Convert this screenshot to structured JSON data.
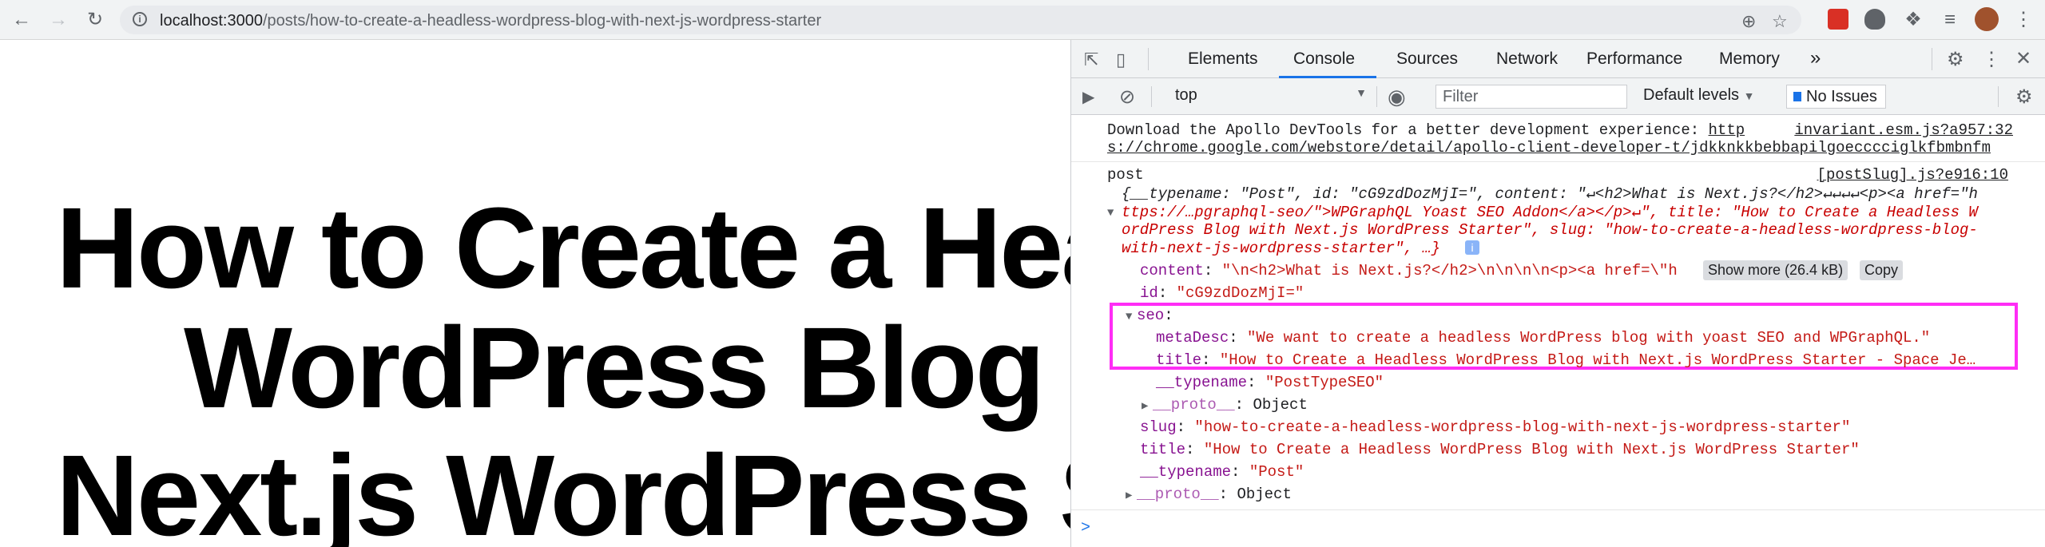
{
  "browser": {
    "url_host": "localhost:3000",
    "url_path": "/posts/how-to-create-a-headless-wordpress-blog-with-next-js-wordpress-starter",
    "icons": [
      "back-icon",
      "forward-icon",
      "reload-icon",
      "site-info-icon",
      "zoom-icon",
      "bookmark-star-icon",
      "extension-icon",
      "puzzle-icon",
      "reading-list-icon",
      "profile-avatar",
      "menu-icon"
    ]
  },
  "page": {
    "title_line1": "How to Create a Hea",
    "title_line2": "WordPress Blog w",
    "title_line3": "Next.js WordPress St"
  },
  "devtools": {
    "tabs": [
      "Elements",
      "Console",
      "Sources",
      "Network",
      "Performance",
      "Memory"
    ],
    "more_tabs": "»",
    "active_tab": "Console",
    "context": "top",
    "filter_placeholder": "Filter",
    "levels": "Default levels",
    "issues": "No Issues",
    "console": {
      "apollo_msg_1": "Download the Apollo DevTools for a better development experience: ",
      "apollo_link_1": "http",
      "apollo_link_2": "s://chrome.google.com/webstore/detail/apollo-client-developer-t/jdkknkkbebbapilgoecccciglkfbmbnfm",
      "apollo_src": "invariant.esm.js?a957:32",
      "post_label": "post",
      "post_src": "[postSlug].js?e916:10",
      "summary_1": "{__typename: \"Post\", id: \"cG9zdDozMjI=\", content: \"↵<h2>What is Next.js?</h2>↵↵↵↵<p><a href=\"h",
      "summary_2": "ttps://…pgraphql-seo/\">WPGraphQL Yoast SEO Addon</a></p>↵\", title: \"How to Create a Headless W",
      "summary_3": "ordPress Blog with Next.js WordPress Starter\", slug: \"how-to-create-a-headless-wordpress-blog-",
      "summary_4": "with-next-js-wordpress-starter\", …}",
      "content_key": "content",
      "content_val": "\"\\n<h2>What is Next.js?</h2>\\n\\n\\n\\n<p><a href=\\\"h",
      "show_more": "Show more (26.4 kB)",
      "copy": "Copy",
      "id_key": "id",
      "id_val": "\"cG9zdDozMjI=\"",
      "seo_key": "seo",
      "metadesc_key": "metaDesc",
      "metadesc_val": "\"We want to create a headless WordPress blog with yoast SEO and WPGraphQL.\"",
      "seo_title_key": "title",
      "seo_title_val": "\"How to Create a Headless WordPress Blog with Next.js WordPress Starter - Space Je…",
      "seo_typename_key": "__typename",
      "seo_typename_val": "\"PostTypeSEO\"",
      "seo_proto_key": "__proto__",
      "seo_proto_val": "Object",
      "slug_key": "slug",
      "slug_val": "\"how-to-create-a-headless-wordpress-blog-with-next-js-wordpress-starter\"",
      "title_key": "title",
      "title_val": "\"How to Create a Headless WordPress Blog with Next.js WordPress Starter\"",
      "typename_key": "__typename",
      "typename_val": "\"Post\"",
      "proto_key": "__proto__",
      "proto_val": "Object",
      "prompt": ">"
    }
  },
  "colors": {
    "highlight": "#ff2df6",
    "accent": "#1a73e8"
  }
}
